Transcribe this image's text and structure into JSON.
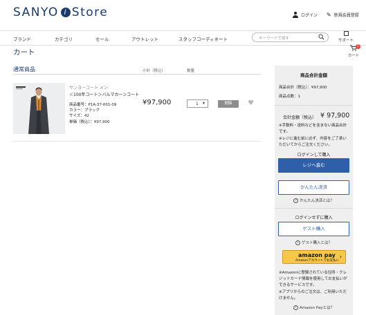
{
  "header": {
    "logo_left": "SANYO",
    "logo_i": "i",
    "logo_right": "Store",
    "login_label": "ログイン",
    "register_label": "新規会員登録"
  },
  "nav": {
    "items": [
      "ブランド",
      "カテゴリ",
      "セール",
      "アウトレット",
      "スタッフコーディネート"
    ],
    "search_placeholder": "キーワードで探す",
    "support_label": "サポート",
    "cart_label": "カート",
    "cart_count": "1"
  },
  "page": {
    "title": "カート"
  },
  "cart": {
    "section_title": "通常商品",
    "col_subtotal": "小計（税込）",
    "col_quantity": "数量",
    "item": {
      "brand": "サンヨーコート メン",
      "name": "＜100年コート＞バルマカーンコート",
      "product_code": "商品番号：P1A-37-001-09",
      "color": "カラー：ブラック",
      "size": "サイズ：42",
      "unit_price": "単価（税込）：¥97,900",
      "subtotal": "¥97,900",
      "quantity": "1",
      "delete_label": "削除"
    }
  },
  "summary": {
    "title": "商品合計金額",
    "subtotal_line": "商品合計（税込）：¥97,900",
    "count_line": "商品点数：1",
    "total_label": "合計金額（税込）",
    "total_value": "¥ 97,900",
    "note1": "※手数料・送料などを含まない商品合計です。",
    "note2": "※レジに進む前に必ず、内容をご了承いただいてからご注文ください。",
    "login_purchase_heading": "ログインして購入",
    "register_button": "レジへ進む",
    "easy_pay_button": "かんたん決済",
    "easy_pay_help": "かんたん決済とは？",
    "guest_heading": "ログインせずに購入",
    "guest_button": "ゲスト購入",
    "guest_help": "ゲスト購入とは？",
    "amazon_pay_label": "amazon pay",
    "amazon_pay_sub": "Amazonアカウントでお支払い",
    "amazon_note1": "※Amazonに登録されている住所・クレジットカード情報を使用してお支払いができるサービスです。",
    "amazon_note2": "※アプリからのご注文は、ご利用いただけません。",
    "amazon_help": "Amazon Payとは？"
  },
  "colors": {
    "brand_navy": "#1a3a6b",
    "primary_button": "#2f5fa8",
    "panel_bg": "#efefef",
    "delete_button": "#8c8c8c",
    "amazon_yellow": "#f6c74a",
    "badge_red": "#e0483e"
  },
  "icons": [
    "person-icon",
    "pencil-icon",
    "search-icon",
    "support-icon",
    "cart-icon",
    "heart-icon",
    "question-icon",
    "chevron-right-icon"
  ]
}
